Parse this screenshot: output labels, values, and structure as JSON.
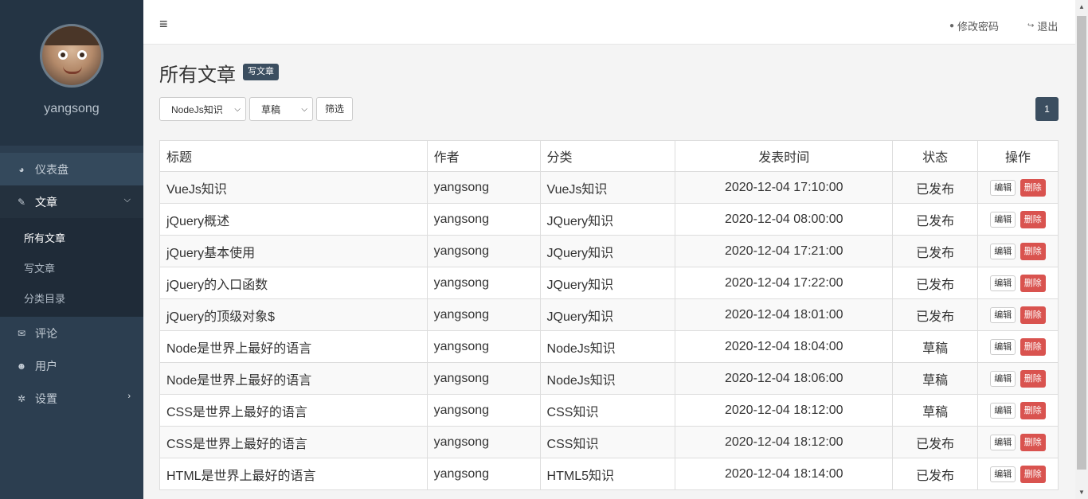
{
  "sidebar": {
    "username": "yangsong",
    "nav": [
      {
        "icon": "dashboard-icon",
        "glyph": "◕",
        "label": "仪表盘"
      },
      {
        "icon": "pin-icon",
        "glyph": "✎",
        "label": "文章"
      },
      {
        "icon": "comments-icon",
        "glyph": "✉",
        "label": "评论"
      },
      {
        "icon": "users-icon",
        "glyph": "☻",
        "label": "用户"
      },
      {
        "icon": "settings-icon",
        "glyph": "✲",
        "label": "设置"
      }
    ],
    "subnav": [
      "所有文章",
      "写文章",
      "分类目录"
    ]
  },
  "topbar": {
    "menu_glyph": "≡",
    "change_password": "修改密码",
    "logout": "退出"
  },
  "page": {
    "title": "所有文章",
    "write_button": "写文章",
    "filters": {
      "category": "NodeJs知识",
      "status": "草稿",
      "submit": "筛选"
    },
    "pagination": "1"
  },
  "table": {
    "headers": [
      "标题",
      "作者",
      "分类",
      "发表时间",
      "状态",
      "操作"
    ],
    "edit_label": "编辑",
    "delete_label": "删除",
    "rows": [
      {
        "title": "VueJs知识",
        "author": "yangsong",
        "category": "VueJs知识",
        "time": "2020-12-04 17:10:00",
        "status": "已发布"
      },
      {
        "title": "jQuery概述",
        "author": "yangsong",
        "category": "JQuery知识",
        "time": "2020-12-04 08:00:00",
        "status": "已发布"
      },
      {
        "title": "jQuery基本使用",
        "author": "yangsong",
        "category": "JQuery知识",
        "time": "2020-12-04 17:21:00",
        "status": "已发布"
      },
      {
        "title": "jQuery的入口函数",
        "author": "yangsong",
        "category": "JQuery知识",
        "time": "2020-12-04 17:22:00",
        "status": "已发布"
      },
      {
        "title": "jQuery的顶级对象$",
        "author": "yangsong",
        "category": "JQuery知识",
        "time": "2020-12-04 18:01:00",
        "status": "已发布"
      },
      {
        "title": "Node是世界上最好的语言",
        "author": "yangsong",
        "category": "NodeJs知识",
        "time": "2020-12-04 18:04:00",
        "status": "草稿"
      },
      {
        "title": "Node是世界上最好的语言",
        "author": "yangsong",
        "category": "NodeJs知识",
        "time": "2020-12-04 18:06:00",
        "status": "草稿"
      },
      {
        "title": "CSS是世界上最好的语言",
        "author": "yangsong",
        "category": "CSS知识",
        "time": "2020-12-04 18:12:00",
        "status": "草稿"
      },
      {
        "title": "CSS是世界上最好的语言",
        "author": "yangsong",
        "category": "CSS知识",
        "time": "2020-12-04 18:12:00",
        "status": "已发布"
      },
      {
        "title": "HTML是世界上最好的语言",
        "author": "yangsong",
        "category": "HTML5知识",
        "time": "2020-12-04 18:14:00",
        "status": "已发布"
      }
    ]
  }
}
